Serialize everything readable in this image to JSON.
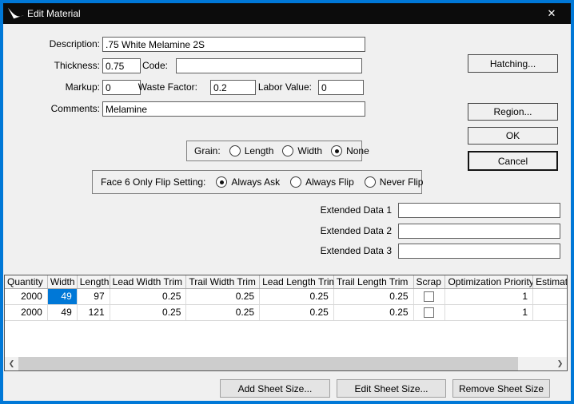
{
  "window": {
    "title": "Edit Material"
  },
  "icons": {
    "close": "✕",
    "app_logo": "swoosh-logo",
    "scroll_left": "❮",
    "scroll_right": "❯"
  },
  "fields": {
    "description": {
      "label": "Description:",
      "value": ".75 White Melamine 2S"
    },
    "thickness": {
      "label": "Thickness:",
      "value": "0.75"
    },
    "code": {
      "label": "Code:",
      "value": ""
    },
    "markup": {
      "label": "Markup:",
      "value": "0"
    },
    "waste_factor": {
      "label": "Waste Factor:",
      "value": "0.2"
    },
    "labor_value": {
      "label": "Labor Value:",
      "value": "0"
    },
    "comments": {
      "label": "Comments:",
      "value": "Melamine"
    },
    "extended_data_1": {
      "label": "Extended Data 1",
      "value": ""
    },
    "extended_data_2": {
      "label": "Extended Data 2",
      "value": ""
    },
    "extended_data_3": {
      "label": "Extended Data 3",
      "value": ""
    }
  },
  "grain": {
    "label": "Grain:",
    "options": [
      {
        "label": "Length",
        "selected": false
      },
      {
        "label": "Width",
        "selected": false
      },
      {
        "label": "None",
        "selected": true
      }
    ]
  },
  "face6": {
    "label": "Face 6 Only Flip Setting:",
    "options": [
      {
        "label": "Always Ask",
        "selected": true
      },
      {
        "label": "Always Flip",
        "selected": false
      },
      {
        "label": "Never Flip",
        "selected": false
      }
    ]
  },
  "buttons": {
    "hatching": "Hatching...",
    "region": "Region...",
    "ok": "OK",
    "cancel": "Cancel",
    "add_sheet": "Add Sheet Size...",
    "edit_sheet": "Edit Sheet Size...",
    "remove_sheet": "Remove Sheet Size"
  },
  "table": {
    "columns": [
      "Quantity",
      "Width",
      "Length",
      "Lead Width Trim",
      "Trail Width Trim",
      "Lead Length Trim",
      "Trail Length Trim",
      "Scrap",
      "Optimization Priority",
      "Estimat"
    ],
    "rows": [
      {
        "quantity": "2000",
        "width": "49",
        "length": "97",
        "lead_width_trim": "0.25",
        "trail_width_trim": "0.25",
        "lead_length_trim": "0.25",
        "trail_length_trim": "0.25",
        "scrap_checked": false,
        "optimization_priority": "1",
        "estimat": ""
      },
      {
        "quantity": "2000",
        "width": "49",
        "length": "121",
        "lead_width_trim": "0.25",
        "trail_width_trim": "0.25",
        "lead_length_trim": "0.25",
        "trail_length_trim": "0.25",
        "scrap_checked": false,
        "optimization_priority": "1",
        "estimat": ""
      }
    ],
    "selected_cell": {
      "row": 0,
      "column": "Width"
    }
  },
  "colors": {
    "accent_border": "#0078d7",
    "titlebar_bg": "#0c0c0c",
    "selection_bg": "#0078d7",
    "dialog_bg": "#f0f0f0"
  }
}
